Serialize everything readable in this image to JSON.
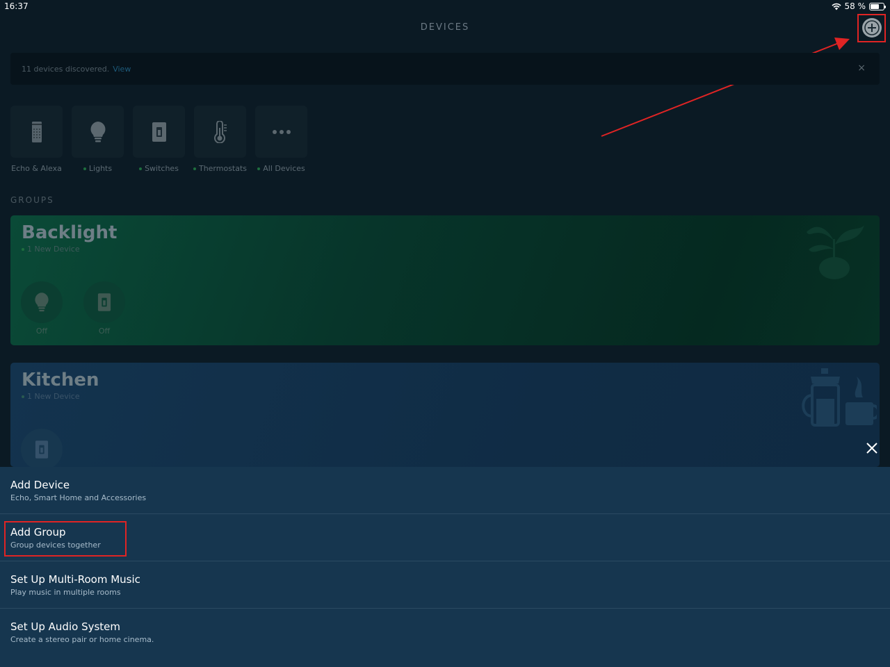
{
  "status_bar": {
    "time": "16:37",
    "battery": "58 %",
    "battery_level": 0.58
  },
  "header": {
    "title": "DEVICES"
  },
  "discover_banner": {
    "text": "11 devices discovered.",
    "link": "View",
    "close": "×"
  },
  "categories": [
    {
      "label": "Echo & Alexa",
      "icon": "echo-speaker-icon",
      "dot": false
    },
    {
      "label": "Lights",
      "icon": "light-bulb-icon",
      "dot": true
    },
    {
      "label": "Switches",
      "icon": "switch-icon",
      "dot": true
    },
    {
      "label": "Thermostats",
      "icon": "thermometer-icon",
      "dot": true
    },
    {
      "label": "All Devices",
      "icon": "more-dots-icon",
      "dot": true
    }
  ],
  "groups": {
    "label": "GROUPS",
    "items": [
      {
        "title": "Backlight",
        "subtitle": "1 New Device",
        "devices": [
          {
            "icon": "light-bulb-icon",
            "state": "Off"
          },
          {
            "icon": "switch-icon",
            "state": "Off"
          }
        ]
      },
      {
        "title": "Kitchen",
        "subtitle": "1 New Device",
        "devices": [
          {
            "icon": "switch-icon",
            "state": ""
          }
        ]
      }
    ]
  },
  "action_sheet": {
    "items": [
      {
        "title": "Add Device",
        "subtitle": "Echo, Smart Home and Accessories"
      },
      {
        "title": "Add Group",
        "subtitle": "Group devices together"
      },
      {
        "title": "Set Up Multi-Room Music",
        "subtitle": "Play music in multiple rooms"
      },
      {
        "title": "Set Up Audio System",
        "subtitle": "Create a stereo pair or home cinema."
      }
    ]
  },
  "colors": {
    "annotation": "#e02424",
    "backlight_card": "#0a4a37",
    "kitchen_card": "#13334e",
    "sheet": "#16364f"
  }
}
